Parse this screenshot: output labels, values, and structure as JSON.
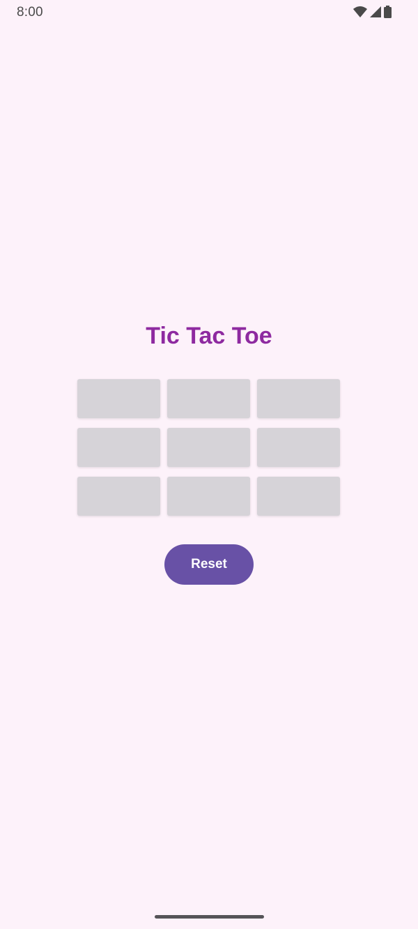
{
  "status_bar": {
    "time": "8:00",
    "icons": [
      "wifi-icon",
      "cellular-signal-icon",
      "battery-icon"
    ]
  },
  "app": {
    "title": "Tic Tac Toe",
    "board": {
      "cells": [
        "",
        "",
        "",
        "",
        "",
        "",
        "",
        "",
        ""
      ]
    },
    "reset_label": "Reset"
  },
  "colors": {
    "background": "#fdf2fa",
    "title": "#8e2aa0",
    "cell": "#d6d3d8",
    "button": "#6851a6"
  }
}
